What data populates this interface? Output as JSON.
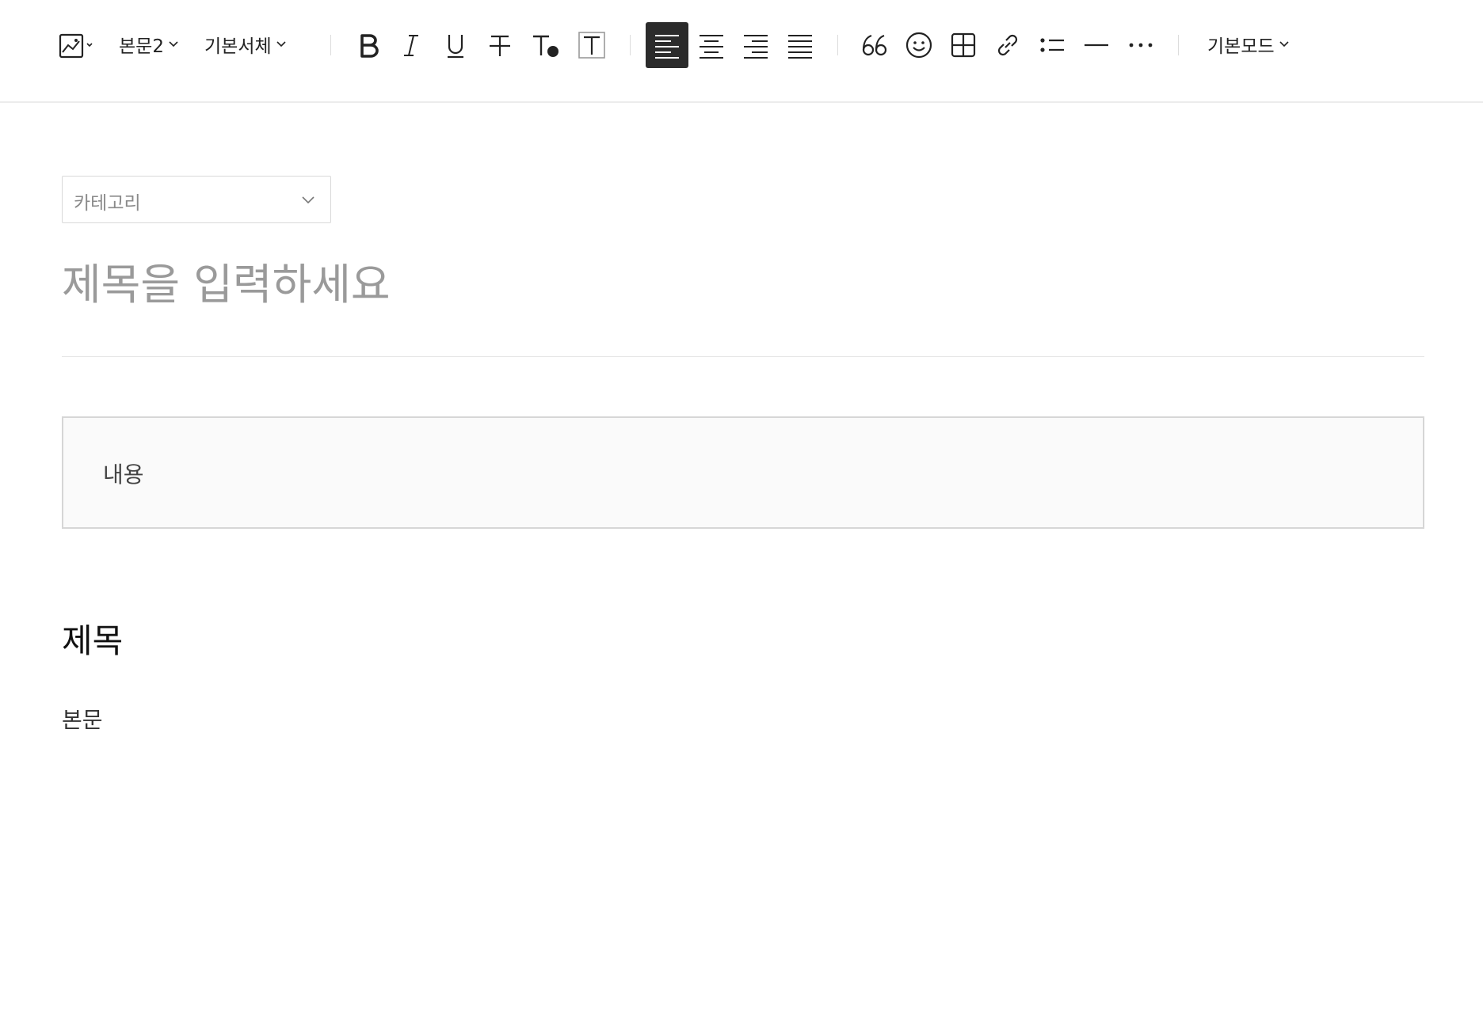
{
  "toolbar": {
    "paragraph_style": "본문2",
    "font_family": "기본서체",
    "mode": "기본모드",
    "active_alignment": "left",
    "icons": [
      "image-icon",
      "bold-icon",
      "italic-icon",
      "underline-icon",
      "strikethrough-icon",
      "text-color-icon",
      "text-background-icon",
      "align-left-icon",
      "align-center-icon",
      "align-right-icon",
      "align-justify-icon",
      "quote-icon",
      "emoji-icon",
      "table-icon",
      "link-icon",
      "list-icon",
      "horizontal-rule-icon",
      "more-icon"
    ]
  },
  "editor": {
    "category_placeholder": "카테고리",
    "title_placeholder": "제목을 입력하세요",
    "content_placeholder": "내용",
    "heading": "제목",
    "body": "본문"
  },
  "colors": {
    "active_button_bg": "#2b2b2b",
    "placeholder_text": "#9a9a9a",
    "content_box_bg": "#fafafa"
  }
}
